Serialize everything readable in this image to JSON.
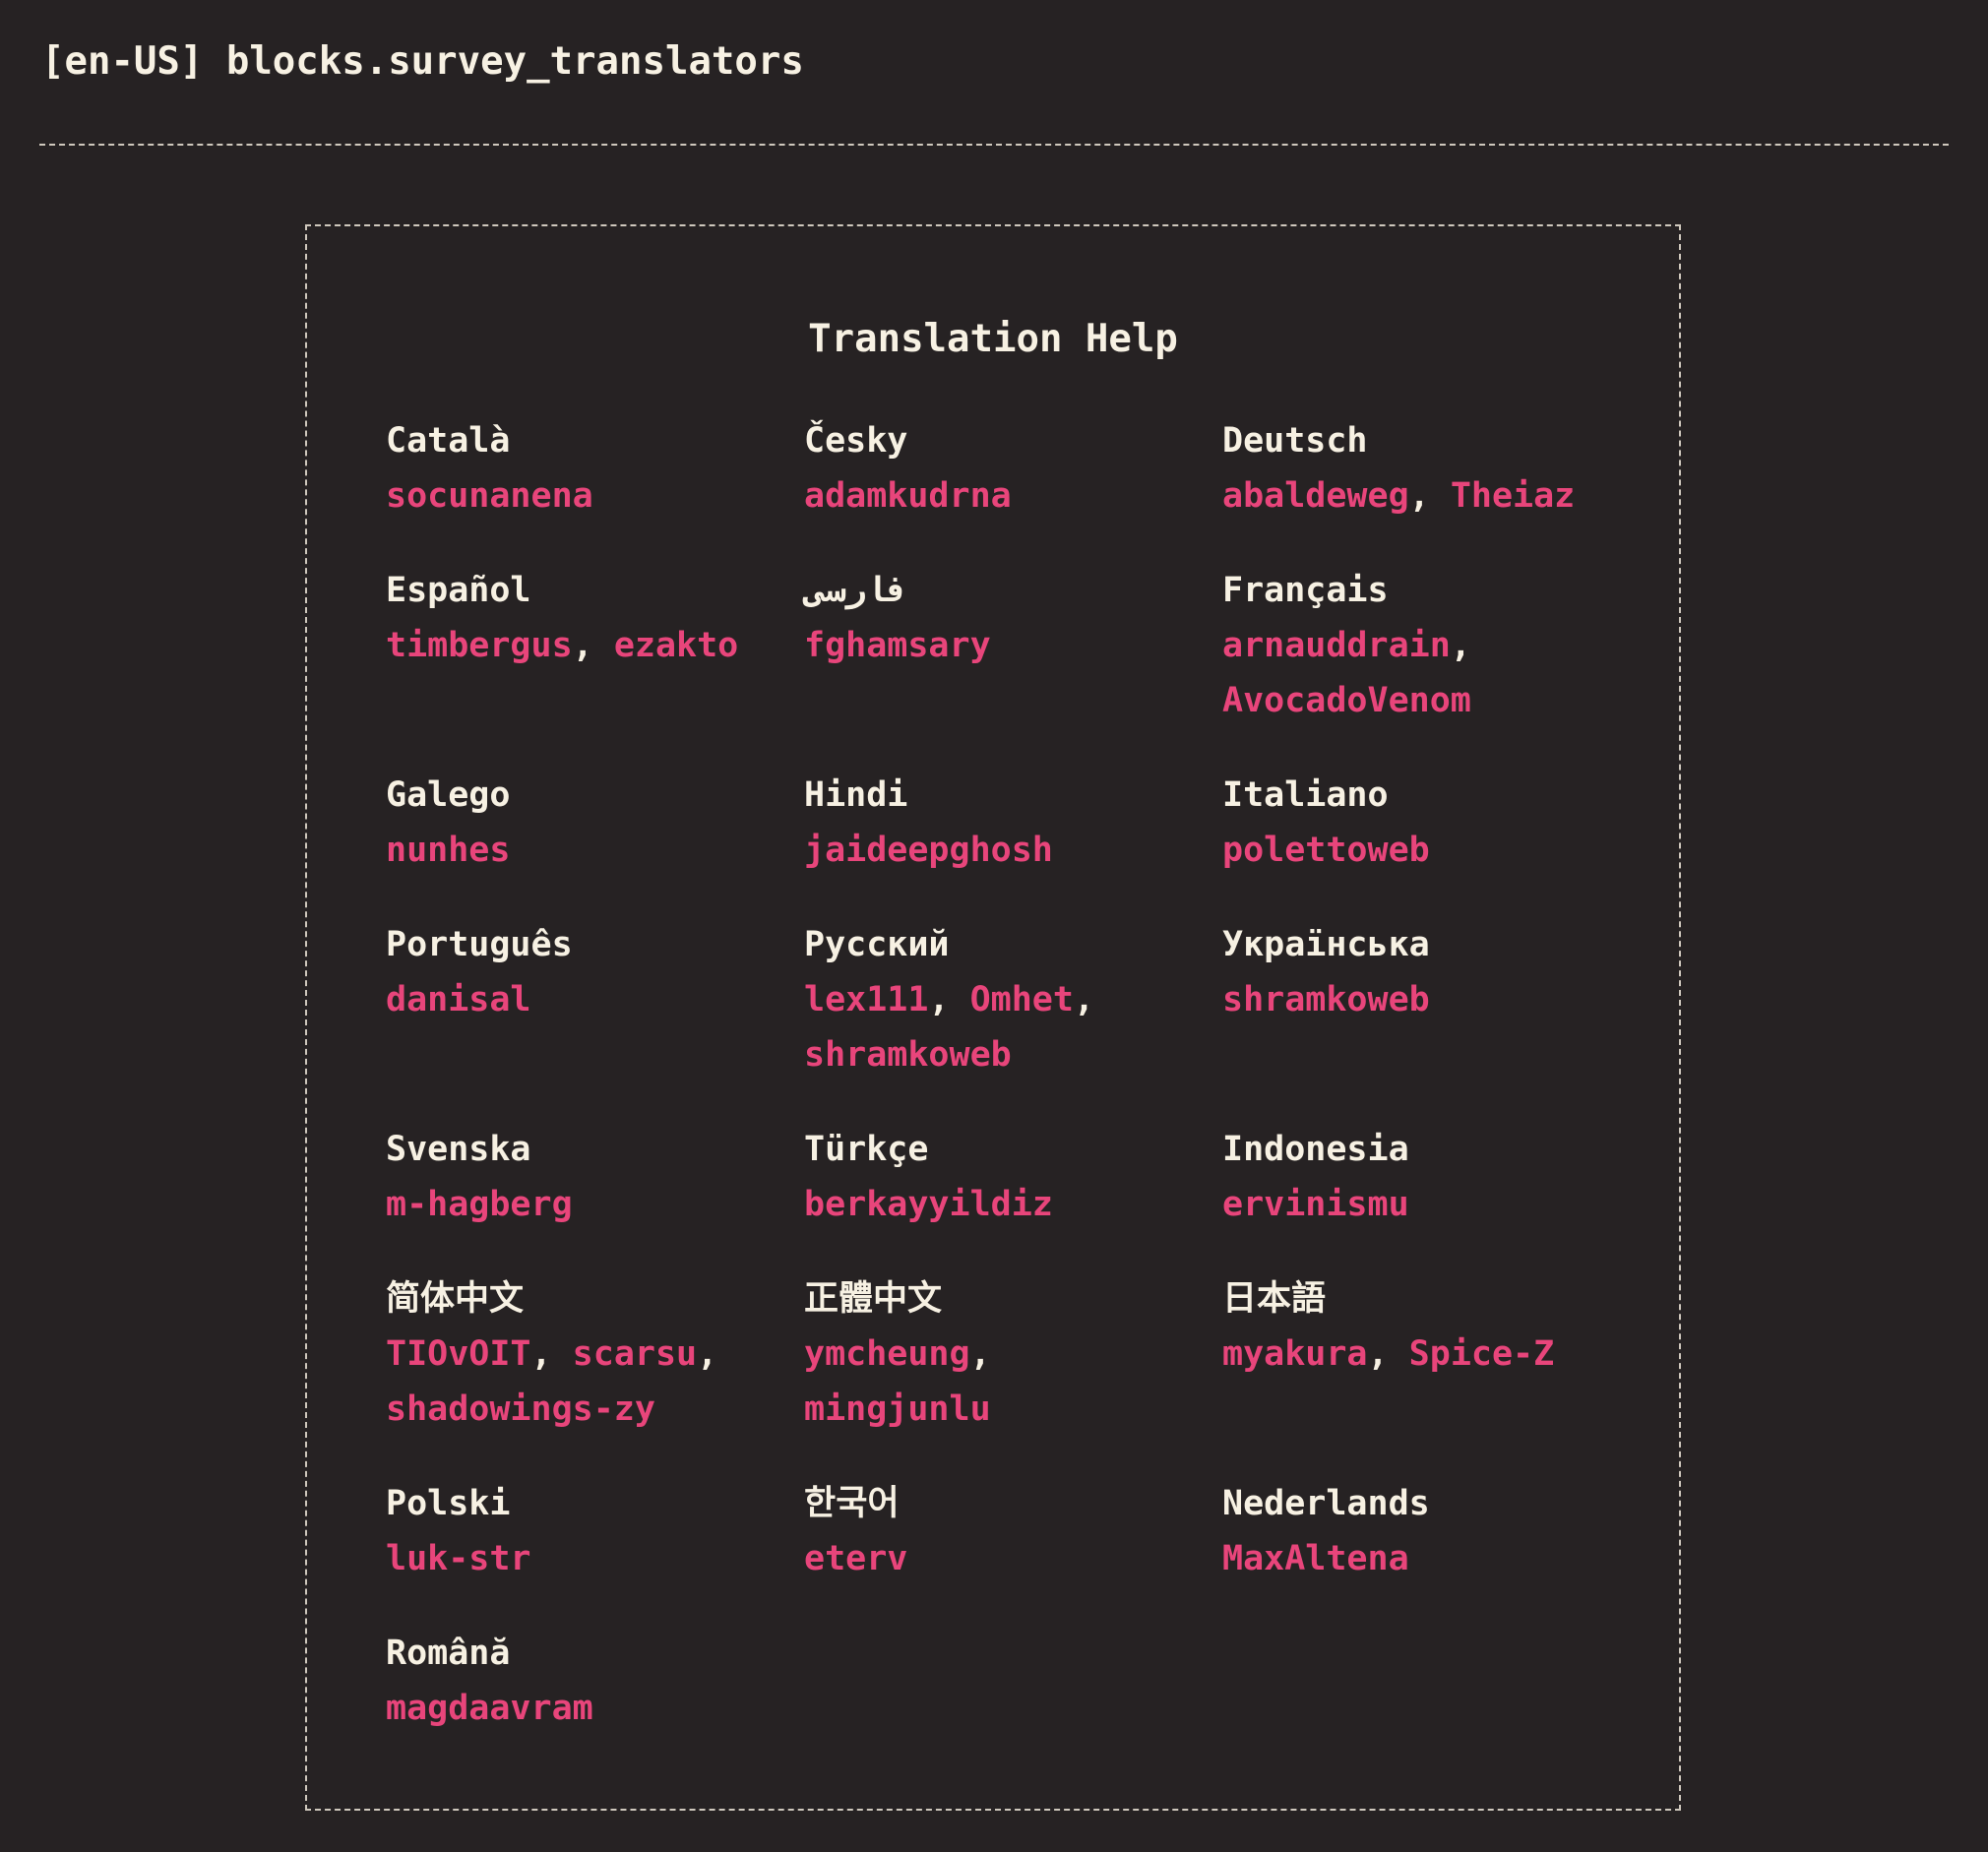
{
  "header": {
    "title": "[en-US] blocks.survey_translators"
  },
  "card": {
    "title": "Translation Help"
  },
  "colors": {
    "background": "#262223",
    "text": "#f7f1e3",
    "accent": "#e8457b"
  },
  "languages": [
    {
      "name": "Català",
      "translators": [
        "socunanena"
      ]
    },
    {
      "name": "Česky",
      "translators": [
        "adamkudrna"
      ]
    },
    {
      "name": "Deutsch",
      "translators": [
        "abaldeweg",
        "Theiaz"
      ]
    },
    {
      "name": "Español",
      "translators": [
        "timbergus",
        "ezakto"
      ]
    },
    {
      "name": "فارسی",
      "translators": [
        "fghamsary"
      ]
    },
    {
      "name": "Français",
      "translators": [
        "arnauddrain",
        "AvocadoVenom"
      ]
    },
    {
      "name": "Galego",
      "translators": [
        "nunhes"
      ]
    },
    {
      "name": "Hindi",
      "translators": [
        "jaideepghosh"
      ]
    },
    {
      "name": "Italiano",
      "translators": [
        "polettoweb"
      ]
    },
    {
      "name": "Português",
      "translators": [
        "danisal"
      ]
    },
    {
      "name": "Русский",
      "translators": [
        "lex111",
        "Omhet",
        "shramkoweb"
      ]
    },
    {
      "name": "Українська",
      "translators": [
        "shramkoweb"
      ]
    },
    {
      "name": "Svenska",
      "translators": [
        "m-hagberg"
      ]
    },
    {
      "name": "Türkçe",
      "translators": [
        "berkayyildiz"
      ]
    },
    {
      "name": "Indonesia",
      "translators": [
        "ervinismu"
      ]
    },
    {
      "name": "简体中文",
      "translators": [
        "TIOvOIT",
        "scarsu",
        "shadowings-zy"
      ]
    },
    {
      "name": "正體中文",
      "translators": [
        "ymcheung",
        "mingjunlu"
      ]
    },
    {
      "name": "日本語",
      "translators": [
        "myakura",
        "Spice-Z"
      ]
    },
    {
      "name": "Polski",
      "translators": [
        "luk-str"
      ]
    },
    {
      "name": "한국어",
      "translators": [
        "eterv"
      ]
    },
    {
      "name": "Nederlands",
      "translators": [
        "MaxAltena"
      ]
    },
    {
      "name": "Română",
      "translators": [
        "magdaavram"
      ]
    }
  ]
}
